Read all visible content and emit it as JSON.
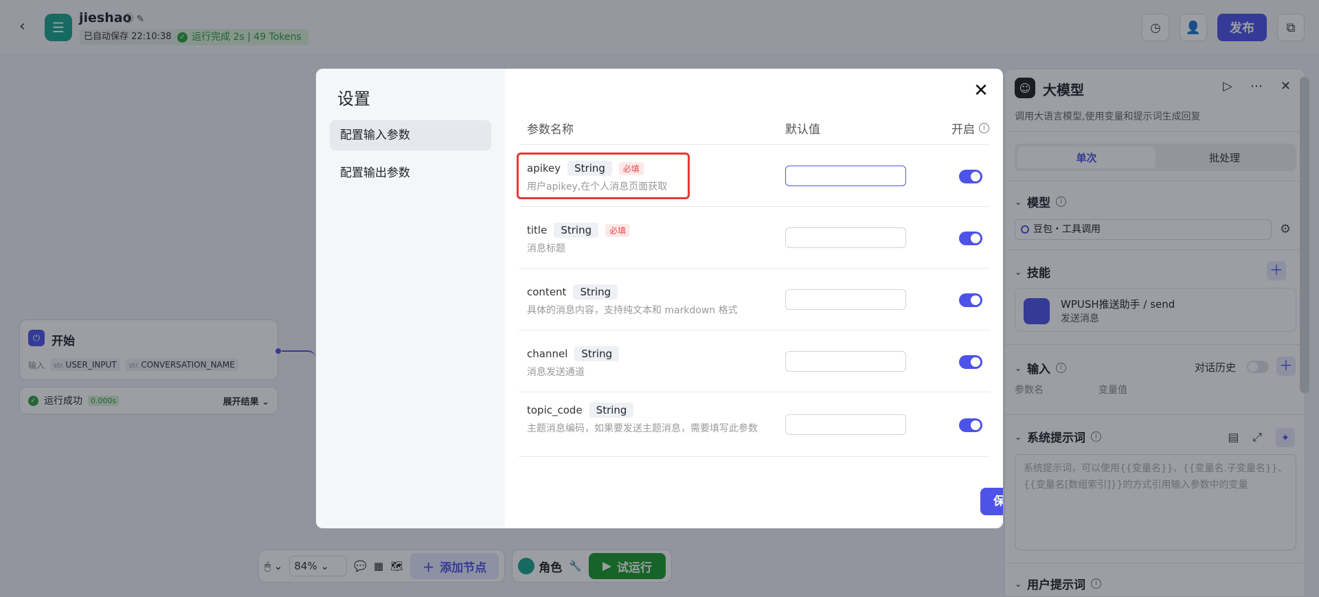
{
  "header": {
    "app_name": "jieshao",
    "autosave": "已自动保存 22:10:38",
    "run_status": "运行完成 2s | 49 Tokens",
    "publish_label": "发布"
  },
  "canvas": {
    "start_node": {
      "title": "开始",
      "inputs_label": "输入",
      "inputs": [
        {
          "type": "str.",
          "name": "USER_INPUT"
        },
        {
          "type": "str.",
          "name": "CONVERSATION_NAME"
        }
      ]
    },
    "result": {
      "label": "运行成功",
      "time": "0.000s",
      "expand": "展开结果"
    }
  },
  "toolbar": {
    "zoom": "84%",
    "add_node": "添加节点",
    "role": "角色",
    "try_run": "试运行"
  },
  "right_panel": {
    "title": "大模型",
    "description": "调用大语言模型,使用变量和提示词生成回复",
    "tabs": [
      "单次",
      "批处理"
    ],
    "model_section": "模型",
    "model_value": "豆包・工具调用",
    "skills_section": "技能",
    "skill": {
      "name": "WPUSH推送助手 / send",
      "sub": "发送消息"
    },
    "input_section": "输入",
    "history_label": "对话历史",
    "col_param": "参数名",
    "col_value": "变量值",
    "system_prompt_section": "系统提示词",
    "system_prompt_placeholder": "系统提示词，可以使用{{变量名}}、{{变量名.子变量名}}、{{变量名[数组索引]}}的方式引用输入参数中的变量",
    "user_prompt_section": "用户提示词"
  },
  "modal": {
    "title": "设置",
    "side_items": [
      "配置输入参数",
      "配置输出参数"
    ],
    "headers": {
      "name": "参数名称",
      "default": "默认值",
      "enabled": "开启"
    },
    "params": [
      {
        "name": "apikey",
        "type": "String",
        "required": "必填",
        "desc": "用户apikey,在个人消息页面获取"
      },
      {
        "name": "title",
        "type": "String",
        "required": "必填",
        "desc": "消息标题"
      },
      {
        "name": "content",
        "type": "String",
        "required": "",
        "desc": "具体的消息内容，支持纯文本和 markdown 格式"
      },
      {
        "name": "channel",
        "type": "String",
        "required": "",
        "desc": "消息发送通道"
      },
      {
        "name": "topic_code",
        "type": "String",
        "required": "",
        "desc": "主题消息编码，如果要发送主题消息，需要填写此参数"
      }
    ],
    "save_label": "保存"
  }
}
